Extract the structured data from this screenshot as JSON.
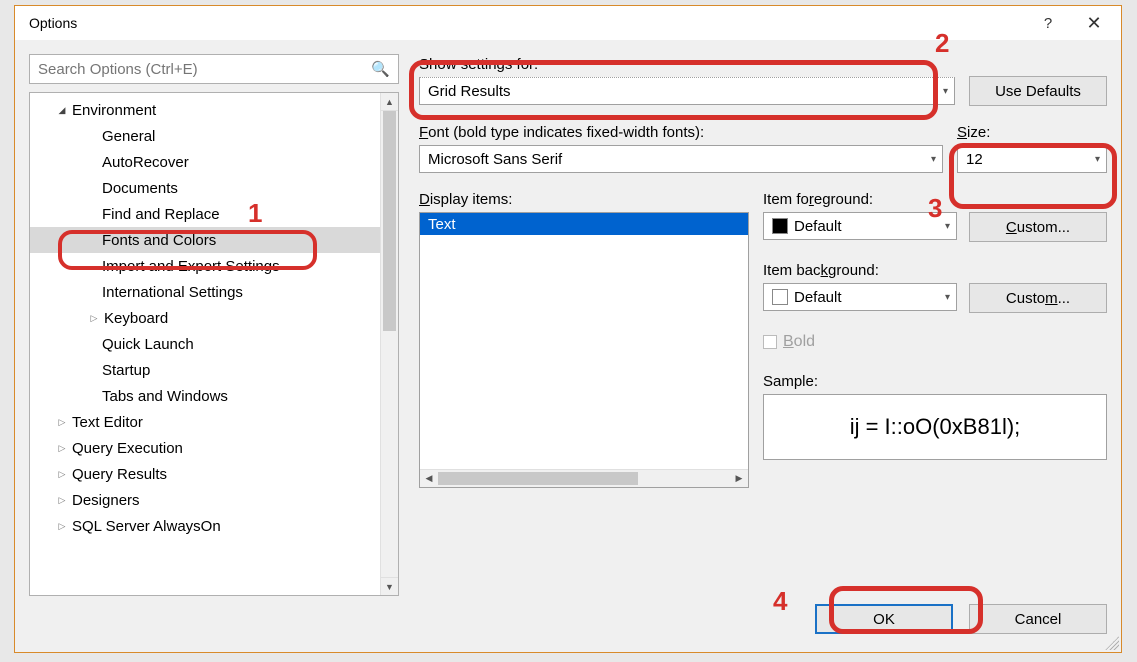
{
  "window": {
    "title": "Options",
    "help_glyph": "?",
    "close_glyph": "✕"
  },
  "search": {
    "placeholder": "Search Options (Ctrl+E)"
  },
  "tree": {
    "items": [
      {
        "label": "Environment",
        "level": 0,
        "expanded": true
      },
      {
        "label": "General",
        "level": 1
      },
      {
        "label": "AutoRecover",
        "level": 1
      },
      {
        "label": "Documents",
        "level": 1
      },
      {
        "label": "Find and Replace",
        "level": 1
      },
      {
        "label": "Fonts and Colors",
        "level": 1,
        "selected": true
      },
      {
        "label": "Import and Export Settings",
        "level": 1
      },
      {
        "label": "International Settings",
        "level": 1
      },
      {
        "label": "Keyboard",
        "level": 1,
        "hasChildren": true
      },
      {
        "label": "Quick Launch",
        "level": 1
      },
      {
        "label": "Startup",
        "level": 1
      },
      {
        "label": "Tabs and Windows",
        "level": 1
      },
      {
        "label": "Text Editor",
        "level": 0,
        "collapsed": true
      },
      {
        "label": "Query Execution",
        "level": 0,
        "collapsed": true
      },
      {
        "label": "Query Results",
        "level": 0,
        "collapsed": true
      },
      {
        "label": "Designers",
        "level": 0,
        "collapsed": true
      },
      {
        "label": "SQL Server AlwaysOn",
        "level": 0,
        "collapsed": true
      }
    ]
  },
  "labels": {
    "show_settings_for": "Show settings for:",
    "use_defaults": "Use Defaults",
    "font": "Font (bold type indicates fixed-width fonts):",
    "size": "Size:",
    "display_items": "Display items:",
    "item_foreground": "Item foreground:",
    "item_background": "Item background:",
    "custom": "Custom...",
    "bold": "Bold",
    "sample": "Sample:",
    "ok": "OK",
    "cancel": "Cancel"
  },
  "values": {
    "show_settings_for": "Grid Results",
    "font": "Microsoft Sans Serif",
    "size": "12",
    "foreground": "Default",
    "background": "Default",
    "sample_text": "ij = I::oO(0xB81l);"
  },
  "display_items": [
    "Text"
  ],
  "annotations": {
    "n1": "1",
    "n2": "2",
    "n3": "3",
    "n4": "4"
  }
}
